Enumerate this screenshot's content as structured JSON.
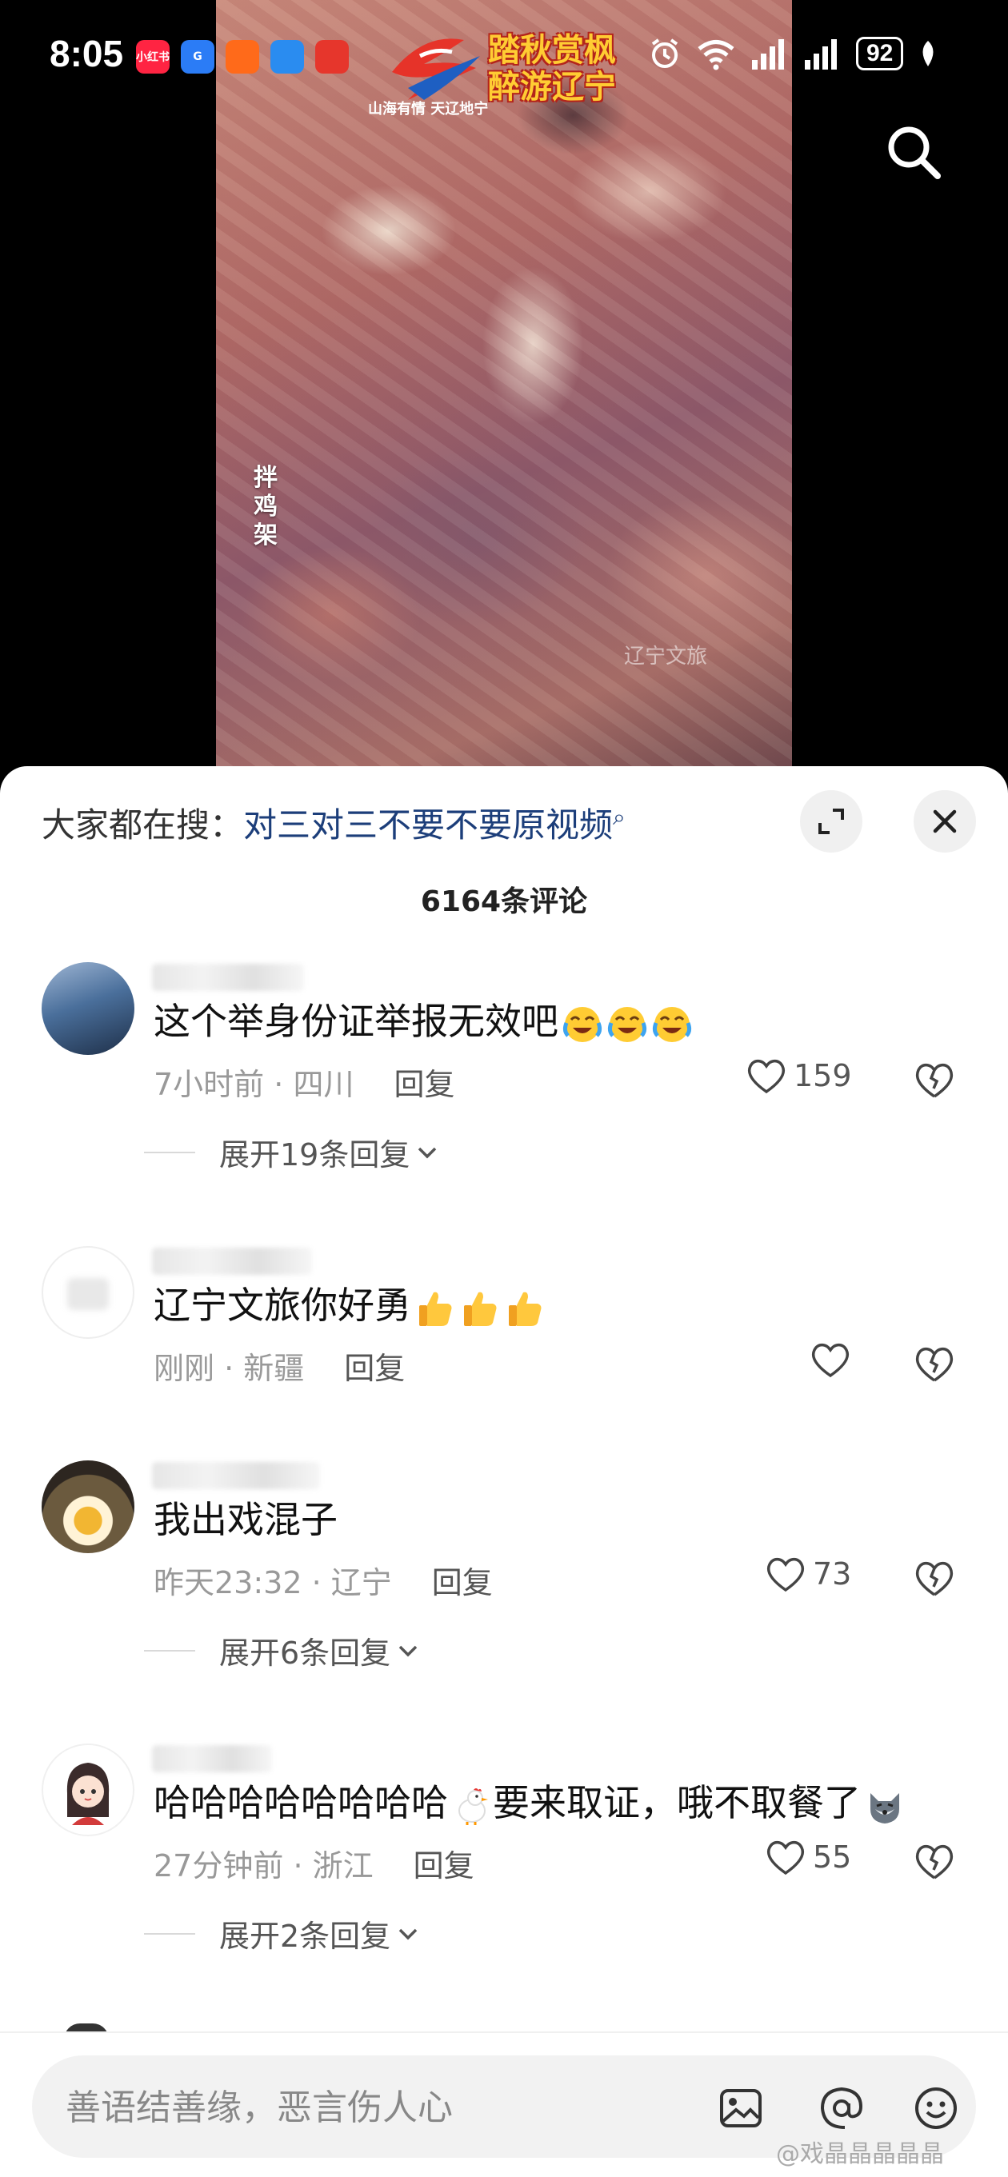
{
  "status_bar": {
    "time": "8:05",
    "battery": "92",
    "app_icons": [
      {
        "name": "xiaohongshu-icon",
        "label": "小红书",
        "color": "#ff2442"
      },
      {
        "name": "app-g-icon",
        "label": "G",
        "color": "#2b7cf6"
      },
      {
        "name": "runner-icon",
        "label": "",
        "color": "#ff6a1a"
      },
      {
        "name": "cloud-icon",
        "label": "",
        "color": "#2a8cf0"
      },
      {
        "name": "gift-icon",
        "label": "",
        "color": "#e6362c"
      }
    ]
  },
  "video": {
    "caption": "拌鸡架",
    "logo_text": "山海有情 天辽地宁",
    "banner_text": "踏秋赏枫 醉游辽宁",
    "watermark": "辽宁文旅"
  },
  "sheet": {
    "hot_search_label": "大家都在搜：",
    "hot_search_keyword": "对三对三不要不要原视频",
    "comment_count": "6164条评论"
  },
  "comments": [
    {
      "text": "这个举身份证举报无效吧",
      "emoji": "cry-laugh",
      "emoji_count": 3,
      "time": "7小时前",
      "location": "四川",
      "reply": "回复",
      "likes": "159",
      "expand": "展开19条回复"
    },
    {
      "text": "辽宁文旅你好勇",
      "emoji": "thumbs-up",
      "emoji_count": 3,
      "time": "刚刚",
      "location": "新疆",
      "reply": "回复",
      "likes": "",
      "expand": ""
    },
    {
      "text": "我出戏混子",
      "emoji": "",
      "emoji_count": 0,
      "time": "昨天23:32",
      "location": "辽宁",
      "reply": "回复",
      "likes": "73",
      "expand": "展开6条回复"
    },
    {
      "text": "哈哈哈哈哈哈哈哈",
      "text2": "要来取证，哦不取餐了",
      "emoji": "chicken",
      "emoji_end": "wolf",
      "time": "27分钟前",
      "location": "浙江",
      "reply": "回复",
      "likes": "55",
      "expand": "展开2条回复"
    }
  ],
  "input": {
    "placeholder": "善语结善缘，恶言伤人心"
  },
  "corner_watermark": "@戏晶晶晶晶晶"
}
